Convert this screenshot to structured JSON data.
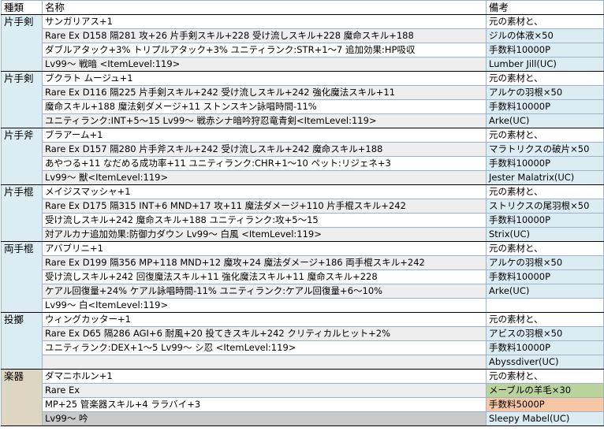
{
  "headers": {
    "type": "種類",
    "name": "名称",
    "note": "備考"
  },
  "groups": [
    {
      "category": "片手剣",
      "rows": [
        {
          "name": "サンガリアス+1",
          "note": "元の素材と、"
        },
        {
          "name": "Rare Ex D158 隔281 攻+26 片手剣スキル+228 受け流しスキル+228 魔命スキル+188",
          "note": "ジルの体液×50"
        },
        {
          "name": "ダブルアタック+3% トリプルアタック+3% ユニティランク:STR+1～7 追加効果:HP吸収",
          "note": "手数料10000P"
        },
        {
          "name": "Lv99～ 戦暗 <ItemLevel:119>",
          "note": "Lumber Jill(UC)"
        }
      ]
    },
    {
      "category": "片手剣",
      "rows": [
        {
          "name": "ブクラト ムージュ+1",
          "note": "元の素材と、"
        },
        {
          "name": "Rare Ex D116 隔225 片手剣スキル+242 受け流しスキル+242 強化魔法スキル+11",
          "note": "アルケの羽根×50"
        },
        {
          "name": "魔命スキル+188 魔法剣ダメージ+11 ストンスキン詠唱時間-11%",
          "note": "手数料10000P"
        },
        {
          "name": "ユニティランク:INT+5～15 Lv99～ 戦赤シナ暗吟狩忍竜青剣<ItemLevel:119>",
          "note": "Arke(UC)"
        }
      ]
    },
    {
      "category": "片手斧",
      "rows": [
        {
          "name": "ブラアーム+1",
          "note": "元の素材と、"
        },
        {
          "name": "Rare Ex D157 隔280 片手斧スキル+242 受け流しスキル+242 魔命スキル+188",
          "note": "マラトリクスの破片×50"
        },
        {
          "name": "あやつる+11 なだめる成功率+11 ユニティランク:CHR+1～10 ペット:リジェネ+3",
          "note": "手数料10000P"
        },
        {
          "name": "Lv99～ 獣<ItemLevel:119>",
          "note": "Jester Malatrix(UC)"
        }
      ]
    },
    {
      "category": "片手棍",
      "rows": [
        {
          "name": "メイジスマッシャ+1",
          "note": "元の素材と、"
        },
        {
          "name": "Rare Ex D175 隔315 INT+6 MND+17 攻+11 魔法ダメージ+110 片手棍スキル+242",
          "note": "ストリクスの尾羽根×50"
        },
        {
          "name": "受け流しスキル+242 魔命スキル+188 ユニティランク:攻+5～15",
          "note": "手数料10000P"
        },
        {
          "name": "対アルカナ追加効果:防御力ダウン Lv99～ 白風 <ItemLevel:119>",
          "note": "Strix(UC)"
        }
      ]
    },
    {
      "category": "両手棍",
      "rows": [
        {
          "name": "アバブリニ+1",
          "note": "元の素材と、"
        },
        {
          "name": "Rare Ex D199 隔356 MP+118 MND+12 魔攻+24 魔法ダメージ+186 両手棍スキル+242",
          "note": "アルケの羽根×50"
        },
        {
          "name": "受け流しスキル+242 回復魔法スキル+11 強化魔法スキル+11 魔命スキル+228",
          "note": "手数料10000P"
        },
        {
          "name": "ケアル回復量+24% ケアル詠唱時間-11% ユニティランク:ケアル回復量+6～10%",
          "note": "Arke(UC)"
        },
        {
          "name": "Lv99～ 白<ItemLevel:119>",
          "note": ""
        }
      ]
    },
    {
      "category": "投擲",
      "rows": [
        {
          "name": "ウィングカッター+1",
          "note": "元の素材と、"
        },
        {
          "name": "Rare Ex D65 隔286 AGI+6 耐風+20 投てきスキル+242 クリティカルヒット+2%",
          "note": "アビスの羽根×50"
        },
        {
          "name": "ユニティランク:DEX+1～5 Lv99～ シ忍 <ItemLevel:119>",
          "note": "手数料10000P"
        },
        {
          "name": "",
          "note": "Abyssdiver(UC)"
        }
      ]
    },
    {
      "category": "楽器",
      "rows": [
        {
          "name": "ダマニホルン+1",
          "note": "元の素材と、"
        },
        {
          "name": "Rare Ex",
          "note": "メーブルの羊毛×30"
        },
        {
          "name": "MP+25 管楽器スキル+4 ララバイ+3",
          "note": "手数料5000P"
        },
        {
          "name": "Lv99～ 吟",
          "note": "Sleepy Mabel(UC)"
        }
      ]
    }
  ],
  "colors": {
    "category_bg": "#dcecf3",
    "category_bg_instrument": "#ddd6c2",
    "note_blue": "#dcecf3",
    "note_green": "#b9d39a",
    "note_orange": "#f7c7a5",
    "row_alt": "#eeeeee",
    "row_gray": "#c9c9c9"
  }
}
